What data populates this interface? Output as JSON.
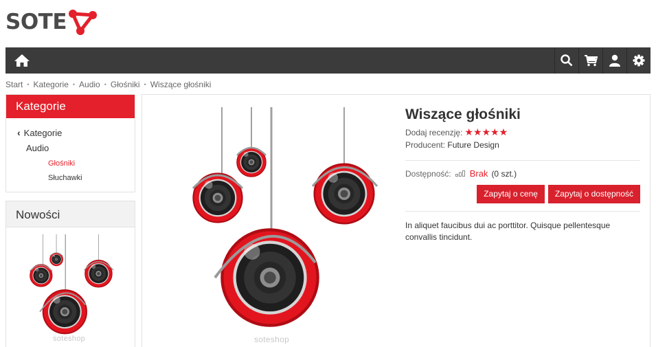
{
  "logo": {
    "text": "SOTE",
    "brand_color": "#e3202b"
  },
  "navbar": {
    "home_icon": "home-icon",
    "icons": [
      "search-icon",
      "cart-icon",
      "user-icon",
      "gear-icon"
    ]
  },
  "breadcrumb": [
    "Start",
    "Kategorie",
    "Audio",
    "Głośniki",
    "Wiszące głośniki"
  ],
  "sidebar": {
    "categories": {
      "title": "Kategorie",
      "back_label": "Kategorie",
      "parent": "Audio",
      "children": [
        {
          "label": "Głośniki",
          "active": true
        },
        {
          "label": "Słuchawki",
          "active": false
        }
      ]
    },
    "news": {
      "title": "Nowości",
      "watermark": "soteshop"
    }
  },
  "product": {
    "title": "Wiszące głośniki",
    "review_label": "Dodaj recenzję:",
    "rating": 5,
    "rating_stars": "★★★★★",
    "producer_label": "Producent:",
    "producer": "Future Design",
    "availability_label": "Dostępność:",
    "availability_status": "Brak",
    "availability_qty": "(0 szt.)",
    "ask_price_button": "Zapytaj o cenę",
    "ask_availability_button": "Zapytaj o dostępność",
    "description": "In aliquet faucibus dui ac porttitor. Quisque pellentesque convallis tincidunt.",
    "image_watermark": "soteshop"
  }
}
